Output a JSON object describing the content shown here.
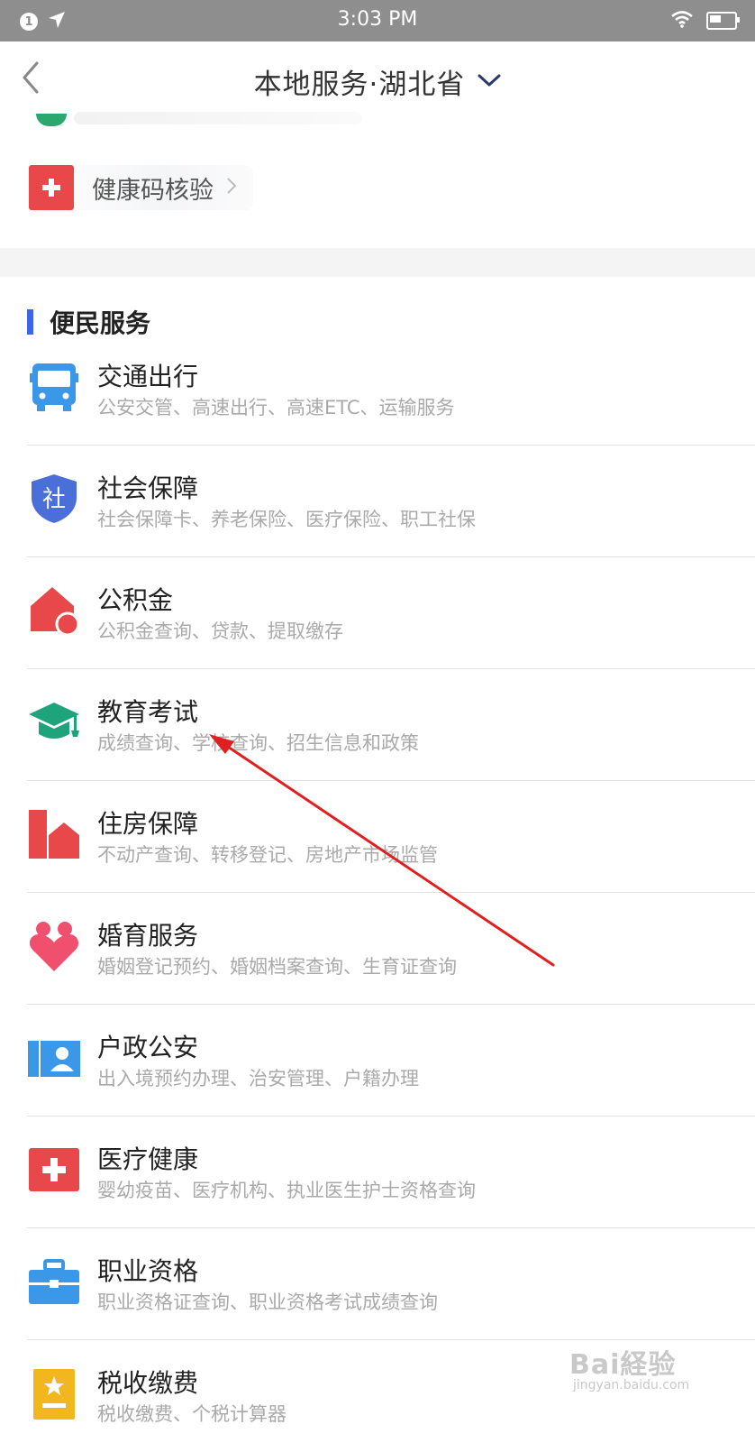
{
  "status_bar": {
    "notification_count": "1",
    "time": "3:03 PM"
  },
  "nav": {
    "title": "本地服务·湖北省"
  },
  "top_section": {
    "health_check_label": "健康码核验"
  },
  "section": {
    "title": "便民服务"
  },
  "services": [
    {
      "title": "交通出行",
      "subtitle": "公安交管、高速出行、高速ETC、运输服务",
      "icon": "bus-icon"
    },
    {
      "title": "社会保障",
      "subtitle": "社会保障卡、养老保险、医疗保险、职工社保",
      "icon": "shield-icon",
      "icon_text": "社"
    },
    {
      "title": "公积金",
      "subtitle": "公积金查询、贷款、提取缴存",
      "icon": "house-fund-icon"
    },
    {
      "title": "教育考试",
      "subtitle": "成绩查询、学校查询、招生信息和政策",
      "icon": "graduation-cap-icon"
    },
    {
      "title": "住房保障",
      "subtitle": "不动产查询、转移登记、房地产市场监管",
      "icon": "housing-icon"
    },
    {
      "title": "婚育服务",
      "subtitle": "婚姻登记预约、婚姻档案查询、生育证查询",
      "icon": "heart-icon"
    },
    {
      "title": "户政公安",
      "subtitle": "出入境预约办理、治安管理、户籍办理",
      "icon": "id-card-icon"
    },
    {
      "title": "医疗健康",
      "subtitle": "婴幼疫苗、医疗机构、执业医生护士资格查询",
      "icon": "medical-cross-icon"
    },
    {
      "title": "职业资格",
      "subtitle": "职业资格证查询、职业资格考试成绩查询",
      "icon": "briefcase-icon"
    },
    {
      "title": "税收缴费",
      "subtitle": "税收缴费、个税计算器",
      "icon": "tax-icon"
    }
  ],
  "watermark": {
    "brand": "Bai経验",
    "url": "jingyan.baidu.com"
  },
  "colors": {
    "section_accent": "#3d66e6",
    "red": "#e8484a",
    "green": "#1fa37a",
    "blue": "#3b97e8",
    "pink": "#f0506e",
    "yellow": "#f2b61e",
    "arrow": "#e02020"
  }
}
